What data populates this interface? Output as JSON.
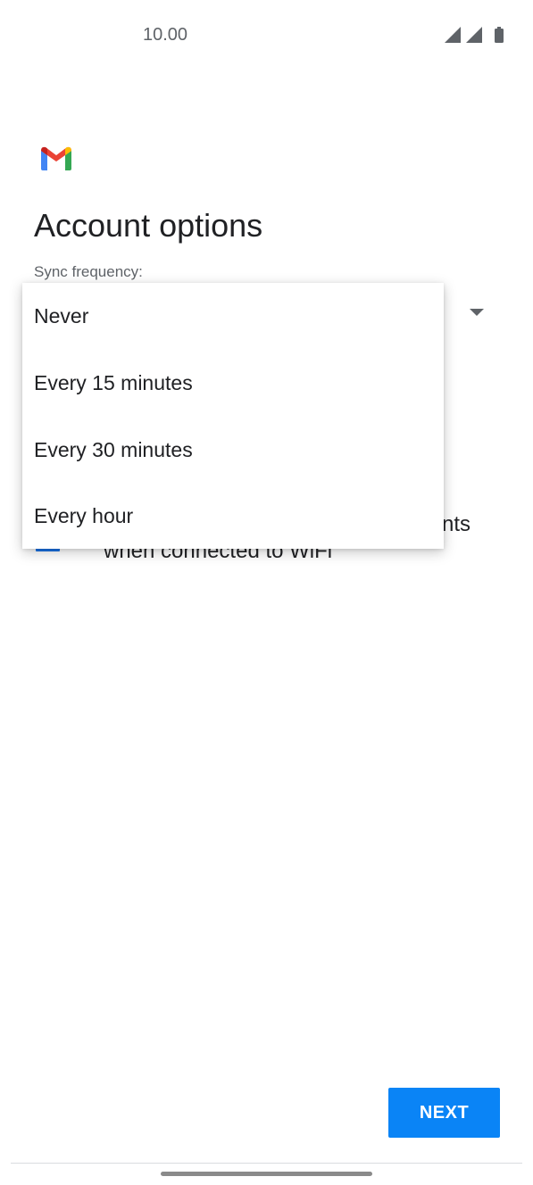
{
  "status_bar": {
    "time": "10.00",
    "icons": [
      "signal-icon",
      "signal-icon",
      "battery-icon"
    ]
  },
  "app": {
    "logo": "gmail-logo"
  },
  "page": {
    "title": "Account options",
    "sync_label": "Sync frequency:"
  },
  "background_content": {
    "option_text_fragment": "nts",
    "option_text_line2": "when connected to WiFi"
  },
  "sync_dropdown": {
    "options": [
      "Never",
      "Every 15 minutes",
      "Every 30 minutes",
      "Every hour"
    ]
  },
  "footer": {
    "next_label": "NEXT"
  },
  "colors": {
    "accent": "#0a84f6",
    "text": "#202124",
    "secondary_text": "#5f6368"
  }
}
